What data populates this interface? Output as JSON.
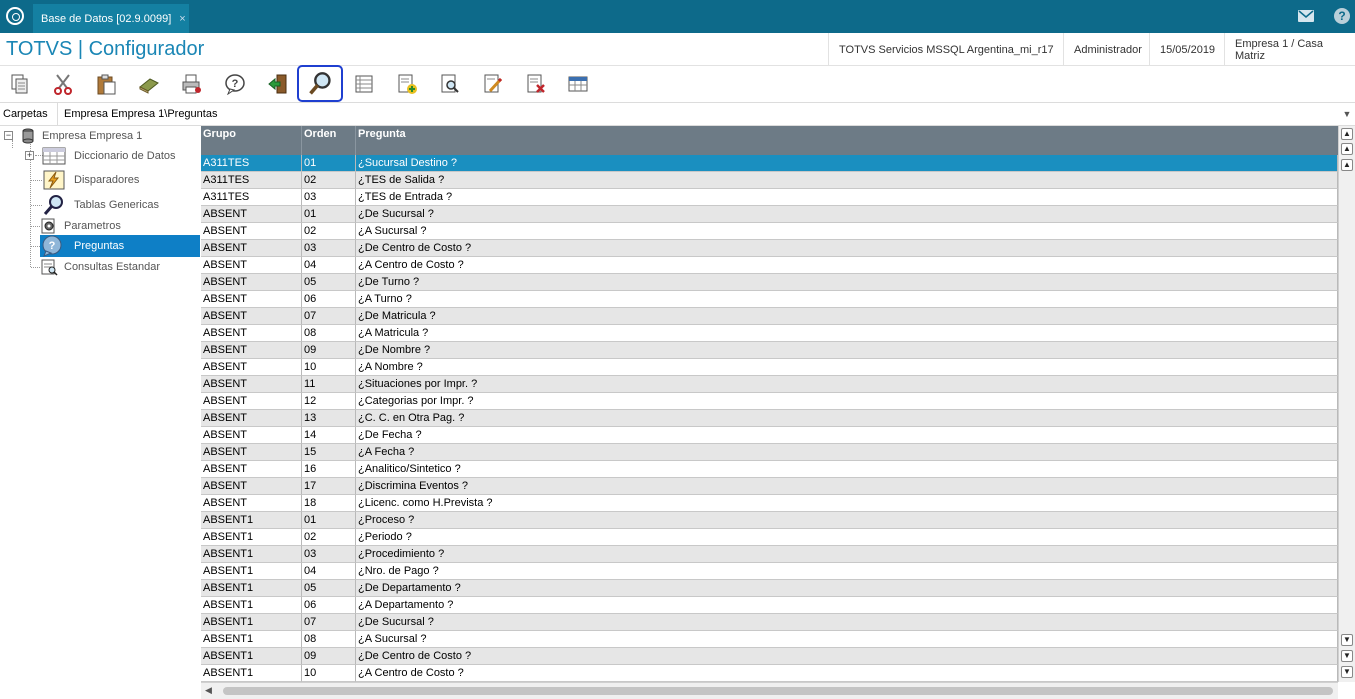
{
  "window": {
    "tab_title": "Base de Datos [02.9.0099]",
    "tab_close": "×",
    "mail_icon": "mail-icon",
    "help_icon": "?"
  },
  "header": {
    "app_title": "TOTVS | Configurador",
    "environment": "TOTVS Servicios MSSQL Argentina_mi_r17",
    "user": "Administrador",
    "date": "15/05/2019",
    "company": "Empresa 1 / Casa Matriz"
  },
  "toolbar": {
    "buttons": [
      "copy-icon",
      "cut-icon",
      "paste-icon",
      "eraser-icon",
      "print-icon",
      "help-icon",
      "exit-icon",
      "search-icon",
      "list-icon",
      "add-icon",
      "preview-icon",
      "edit-icon",
      "delete-icon",
      "table-icon"
    ],
    "active": "search-icon",
    "active_color": "#1f3fd0"
  },
  "folder": {
    "label": "Carpetas",
    "path": "Empresa Empresa 1\\Preguntas"
  },
  "tree": {
    "root": "Empresa Empresa 1",
    "items": [
      {
        "label": "Diccionario de Datos",
        "icon": "table-icon"
      },
      {
        "label": "Disparadores",
        "icon": "lightning-icon"
      },
      {
        "label": "Tablas Genericas",
        "icon": "magnifier-icon"
      },
      {
        "label": "Parametros",
        "icon": "gear-icon"
      },
      {
        "label": "Preguntas",
        "icon": "question-icon"
      },
      {
        "label": "Consultas Estandar",
        "icon": "query-icon"
      }
    ],
    "selected": "Preguntas",
    "selection_color": "#0e7fc6"
  },
  "grid": {
    "columns": [
      "Grupo",
      "Orden",
      "Pregunta"
    ],
    "header_color": "#6d7b86",
    "selected_color": "#1a8fc0",
    "rows": [
      [
        "A311TES",
        "01",
        "¿Sucursal Destino ?"
      ],
      [
        "A311TES",
        "02",
        "¿TES de Salida ?"
      ],
      [
        "A311TES",
        "03",
        "¿TES de Entrada ?"
      ],
      [
        "ABSENT",
        "01",
        "¿De Sucursal ?"
      ],
      [
        "ABSENT",
        "02",
        "¿A Sucursal ?"
      ],
      [
        "ABSENT",
        "03",
        "¿De Centro de Costo ?"
      ],
      [
        "ABSENT",
        "04",
        "¿A Centro de Costo ?"
      ],
      [
        "ABSENT",
        "05",
        "¿De Turno ?"
      ],
      [
        "ABSENT",
        "06",
        "¿A Turno ?"
      ],
      [
        "ABSENT",
        "07",
        "¿De Matricula ?"
      ],
      [
        "ABSENT",
        "08",
        "¿A Matricula ?"
      ],
      [
        "ABSENT",
        "09",
        "¿De Nombre ?"
      ],
      [
        "ABSENT",
        "10",
        "¿A Nombre ?"
      ],
      [
        "ABSENT",
        "11",
        "¿Situaciones por Impr. ?"
      ],
      [
        "ABSENT",
        "12",
        "¿Categorias por Impr. ?"
      ],
      [
        "ABSENT",
        "13",
        "¿C. C. en Otra Pag. ?"
      ],
      [
        "ABSENT",
        "14",
        "¿De Fecha ?"
      ],
      [
        "ABSENT",
        "15",
        "¿A Fecha ?"
      ],
      [
        "ABSENT",
        "16",
        "¿Analitico/Sintetico ?"
      ],
      [
        "ABSENT",
        "17",
        "¿Discrimina Eventos ?"
      ],
      [
        "ABSENT",
        "18",
        "¿Licenc. como H.Prevista ?"
      ],
      [
        "ABSENT1",
        "01",
        "¿Proceso ?"
      ],
      [
        "ABSENT1",
        "02",
        "¿Periodo ?"
      ],
      [
        "ABSENT1",
        "03",
        "¿Procedimiento ?"
      ],
      [
        "ABSENT1",
        "04",
        "¿Nro. de Pago ?"
      ],
      [
        "ABSENT1",
        "05",
        "¿De Departamento ?"
      ],
      [
        "ABSENT1",
        "06",
        "¿A Departamento ?"
      ],
      [
        "ABSENT1",
        "07",
        "¿De Sucursal ?"
      ],
      [
        "ABSENT1",
        "08",
        "¿A Sucursal ?"
      ],
      [
        "ABSENT1",
        "09",
        "¿De Centro de Costo ?"
      ],
      [
        "ABSENT1",
        "10",
        "¿A Centro de Costo ?"
      ]
    ]
  }
}
